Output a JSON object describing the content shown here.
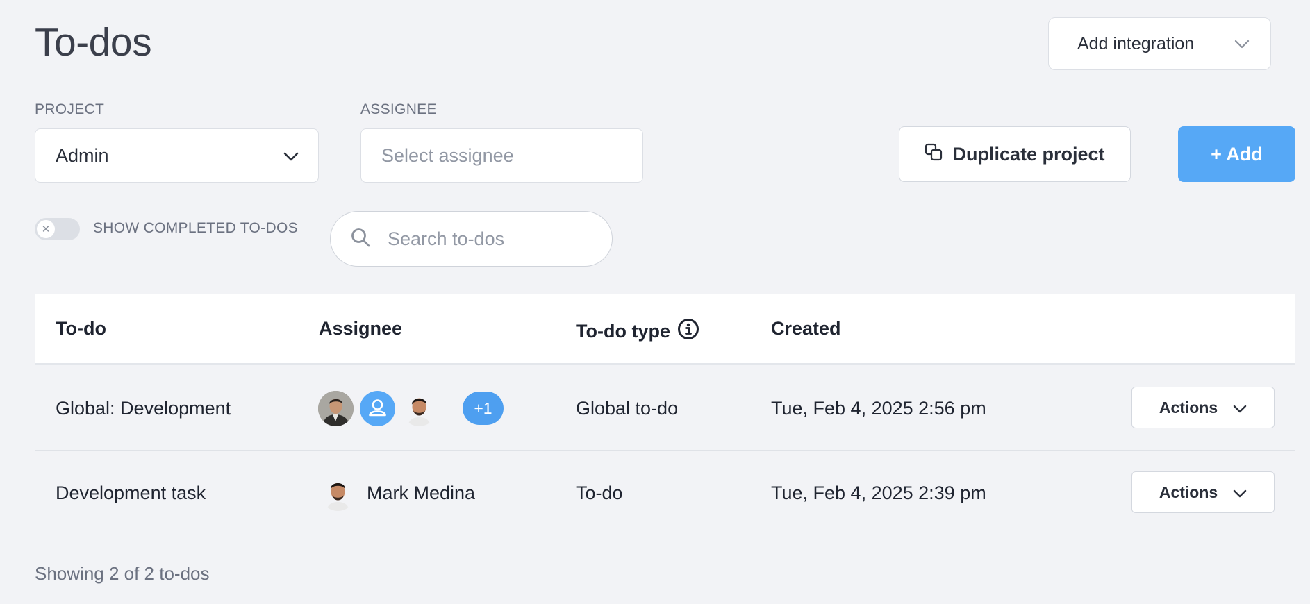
{
  "page": {
    "title": "To-dos"
  },
  "integration": {
    "label": "Add integration"
  },
  "filters": {
    "project_label": "PROJECT",
    "project_value": "Admin",
    "assignee_label": "ASSIGNEE",
    "assignee_placeholder": "Select assignee"
  },
  "buttons": {
    "duplicate": "Duplicate project",
    "add": "+ Add"
  },
  "toggle": {
    "label": "SHOW COMPLETED TO-DOS",
    "checked": false
  },
  "search": {
    "placeholder": "Search to-dos"
  },
  "table": {
    "headers": {
      "todo": "To-do",
      "assignee": "Assignee",
      "type": "To-do type",
      "created": "Created"
    },
    "rows": [
      {
        "todo": "Global: Development",
        "assignee_extra": "+1",
        "type": "Global to-do",
        "created": "Tue, Feb 4, 2025 2:56 pm",
        "actions": "Actions"
      },
      {
        "todo": "Development task",
        "assignee_name": "Mark Medina",
        "type": "To-do",
        "created": "Tue, Feb 4, 2025 2:39 pm",
        "actions": "Actions"
      }
    ]
  },
  "footer": {
    "summary": "Showing 2 of 2 to-dos"
  },
  "colors": {
    "accent": "#56a8f6",
    "background": "#f2f3f6",
    "avatar_badge": "#4e9ff0"
  }
}
